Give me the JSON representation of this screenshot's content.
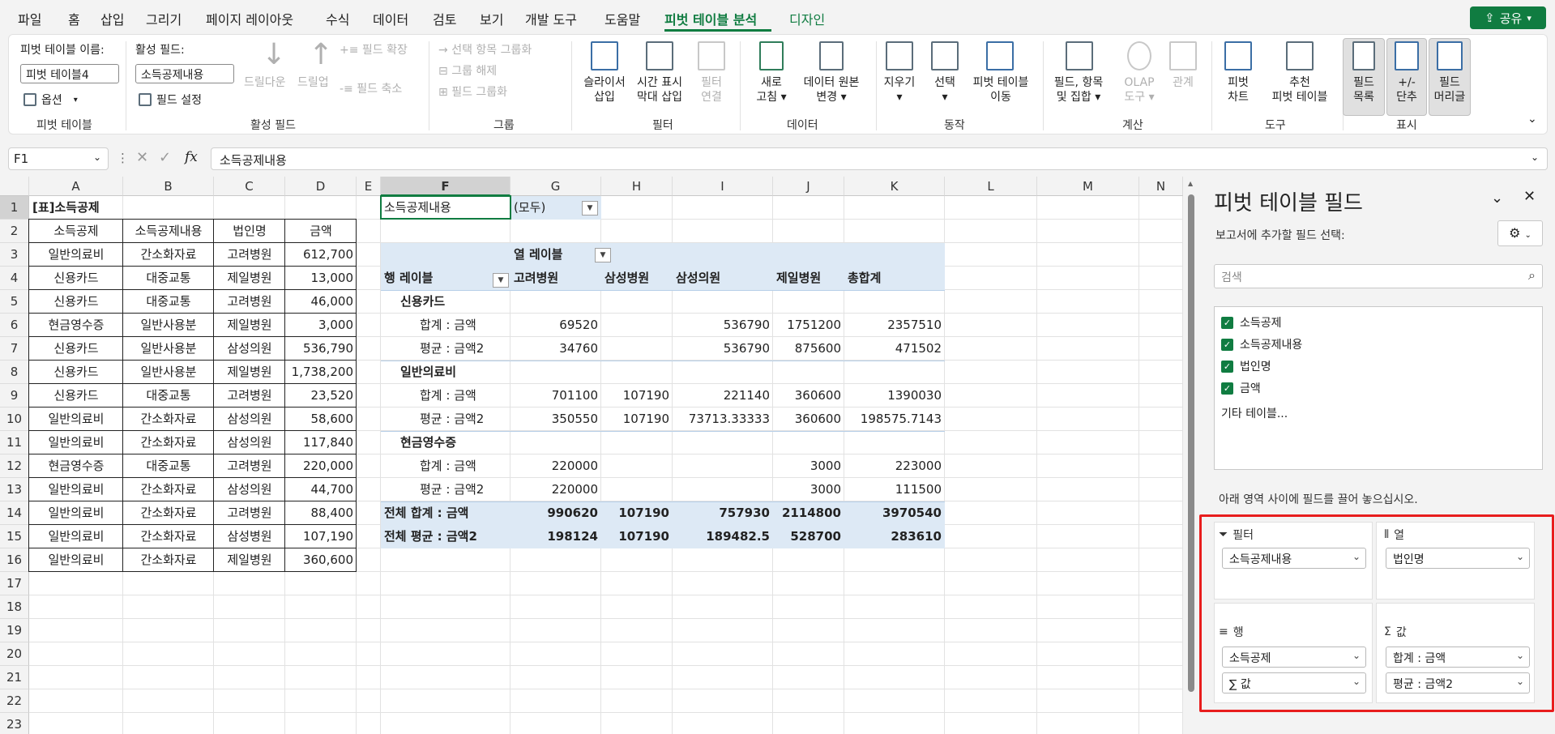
{
  "menu": {
    "items": [
      "파일",
      "홈",
      "삽입",
      "그리기",
      "페이지 레이아웃",
      "수식",
      "데이터",
      "검토",
      "보기",
      "개발 도구",
      "도움말",
      "피벗 테이블 분석",
      "디자인"
    ],
    "share": "공유",
    "accent": "#107c41"
  },
  "ribbon": {
    "pt_name_label": "피벗 테이블 이름:",
    "pt_name_value": "피벗 테이블4",
    "options": "옵션",
    "group_pivot": "피벗 테이블",
    "active_field_label": "활성 필드:",
    "active_field_value": "소득공제내용",
    "field_settings": "필드 설정",
    "drilldown": "드릴다운",
    "drillup": "드릴업",
    "field_expand": "필드 확장",
    "field_collapse": "필드 축소",
    "group_active": "활성 필드",
    "group_selection": "선택 항목 그룹화",
    "ungroup": "그룹 해제",
    "group_field": "필드 그룹화",
    "group_group": "그룹",
    "slicer": [
      "슬라이서",
      "삽입"
    ],
    "timeline": [
      "시간 표시",
      "막대 삽입"
    ],
    "filter_conn": [
      "필터",
      "연결"
    ],
    "group_filter": "필터",
    "refresh": [
      "새로",
      "고침"
    ],
    "change_source": [
      "데이터 원본",
      "변경"
    ],
    "group_data": "데이터",
    "clear": "지우기",
    "select": "선택",
    "move": [
      "피벗 테이블",
      "이동"
    ],
    "group_action": "동작",
    "fields_items": [
      "필드, 항목",
      "및 집합"
    ],
    "olap": [
      "OLAP",
      "도구"
    ],
    "relations": "관계",
    "group_calc": "계산",
    "pivot_chart": [
      "피벗",
      "차트"
    ],
    "recommended": [
      "추천",
      "피벗 테이블"
    ],
    "group_tools": "도구",
    "field_list": [
      "필드",
      "목록"
    ],
    "plus_minus": [
      "+/-",
      "단추"
    ],
    "field_headers": [
      "필드",
      "머리글"
    ],
    "group_show": "표시"
  },
  "formula": {
    "namebox": "F1",
    "fx": "fx",
    "content": "소득공제내용"
  },
  "grid": {
    "columns": [
      "A",
      "B",
      "C",
      "D",
      "E",
      "F",
      "G",
      "H",
      "I",
      "J",
      "K",
      "L",
      "M",
      "N"
    ],
    "rows": [
      "1",
      "2",
      "3",
      "4",
      "5",
      "6",
      "7",
      "8",
      "9",
      "10",
      "11",
      "12",
      "13",
      "14",
      "15",
      "16",
      "17",
      "18",
      "19",
      "20",
      "21",
      "22",
      "23"
    ],
    "table_title": "[표]소득공제",
    "table_headers": [
      "소득공제",
      "소득공제내용",
      "법인명",
      "금액"
    ],
    "table_rows": [
      [
        "일반의료비",
        "간소화자료",
        "고려병원",
        "612,700"
      ],
      [
        "신용카드",
        "대중교통",
        "제일병원",
        "13,000"
      ],
      [
        "신용카드",
        "대중교통",
        "고려병원",
        "46,000"
      ],
      [
        "현금영수증",
        "일반사용분",
        "제일병원",
        "3,000"
      ],
      [
        "신용카드",
        "일반사용분",
        "삼성의원",
        "536,790"
      ],
      [
        "신용카드",
        "일반사용분",
        "제일병원",
        "1,738,200"
      ],
      [
        "신용카드",
        "대중교통",
        "고려병원",
        "23,520"
      ],
      [
        "일반의료비",
        "간소화자료",
        "삼성의원",
        "58,600"
      ],
      [
        "일반의료비",
        "간소화자료",
        "삼성의원",
        "117,840"
      ],
      [
        "현금영수증",
        "대중교통",
        "고려병원",
        "220,000"
      ],
      [
        "일반의료비",
        "간소화자료",
        "삼성의원",
        "44,700"
      ],
      [
        "일반의료비",
        "간소화자료",
        "고려병원",
        "88,400"
      ],
      [
        "일반의료비",
        "간소화자료",
        "삼성병원",
        "107,190"
      ],
      [
        "일반의료비",
        "간소화자료",
        "제일병원",
        "360,600"
      ]
    ]
  },
  "pivot": {
    "filter_label": "소득공제내용",
    "filter_value": "(모두)",
    "col_label": "열 레이블",
    "row_label": "행 레이블",
    "col_headers": [
      "고려병원",
      "삼성병원",
      "삼성의원",
      "제일병원",
      "총합계"
    ],
    "groups": [
      {
        "name": "신용카드",
        "rows": [
          {
            "label": "합계 : 금액",
            "values": [
              "69520",
              "",
              "536790",
              "1751200",
              "2357510"
            ]
          },
          {
            "label": "평균 : 금액2",
            "values": [
              "34760",
              "",
              "536790",
              "875600",
              "471502"
            ]
          }
        ]
      },
      {
        "name": "일반의료비",
        "rows": [
          {
            "label": "합계 : 금액",
            "values": [
              "701100",
              "107190",
              "221140",
              "360600",
              "1390030"
            ]
          },
          {
            "label": "평균 : 금액2",
            "values": [
              "350550",
              "107190",
              "73713.33333",
              "360600",
              "198575.7143"
            ]
          }
        ]
      },
      {
        "name": "현금영수증",
        "rows": [
          {
            "label": "합계 : 금액",
            "values": [
              "220000",
              "",
              "",
              "3000",
              "223000"
            ]
          },
          {
            "label": "평균 : 금액2",
            "values": [
              "220000",
              "",
              "",
              "3000",
              "111500"
            ]
          }
        ]
      }
    ],
    "totals": [
      {
        "label": "전체 합계 : 금액",
        "values": [
          "990620",
          "107190",
          "757930",
          "2114800",
          "3970540"
        ]
      },
      {
        "label": "전체 평균 : 금액2",
        "values": [
          "198124",
          "107190",
          "189482.5",
          "528700",
          "283610"
        ]
      }
    ]
  },
  "pane": {
    "title": "피벗 테이블 필드",
    "subtitle": "보고서에 추가할 필드 선택:",
    "search_placeholder": "검색",
    "fields": [
      "소득공제",
      "소득공제내용",
      "법인명",
      "금액"
    ],
    "other_tables": "기타 테이블...",
    "hint": "아래 영역 사이에 필드를 끌어 놓으십시오.",
    "area_filter": "필터",
    "area_columns": "열",
    "area_rows": "행",
    "area_values": "값",
    "filter_field": "소득공제내용",
    "column_field": "법인명",
    "row_fields": [
      "소득공제",
      "∑ 값"
    ],
    "value_fields": [
      "합계 : 금액",
      "평균 : 금액2"
    ]
  }
}
